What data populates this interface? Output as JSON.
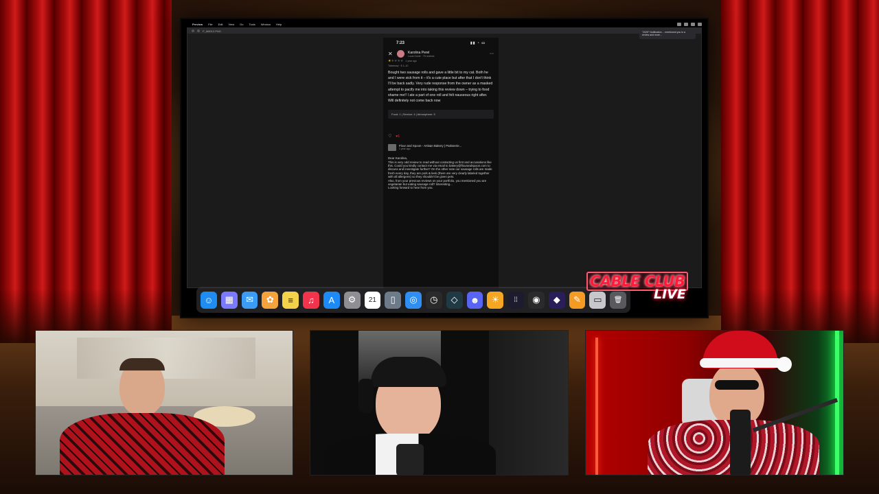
{
  "mac_menu": {
    "app": "Preview",
    "items": [
      "File",
      "Edit",
      "View",
      "Go",
      "Tools",
      "Window",
      "Help"
    ]
  },
  "browser": {
    "tab_title": "P_M8012.PNG",
    "notification": "\"2025\" Notification ... mentioned you in a review and more..."
  },
  "phone": {
    "time": "7:23",
    "review": {
      "reviewer": "Karolina Perel",
      "reviewer_meta": "Local Guide · 75 reviews",
      "stars_text": "★★★★★",
      "ago": "1 year ago",
      "meta": "Takeaway · $ 1–10",
      "text": "Bought two sausage rolls and gave a little bit to my cat. Both he and I were sick from it – it's a cute place but after that I don't think I'll be back sadly. Very rude response from the owner as a masked attempt to pacify me into taking this review down – trying to food shame me!! I ate a part of one roll and felt nauseous right after. Will definitely not come back now",
      "ratings": "Food: 1  |  Service: 4  |  Atmosphere: 5",
      "like_count": "1"
    },
    "owner": {
      "name": "Flour and Spoon - Artisan Bakery | Patisserie...",
      "time": "1 year ago",
      "reply": [
        "Dear Karolina,",
        "This is very odd review to read without contacting us first and accusations like this. Could you kindly contact me via email to bakery@flourandspoon.com to discuss and investigate further? On the other note our sausage rolls are made fresh every day, they are pork & leek (there are very clearly labeled together with all allergens) so they shouldn't be given pets.",
        "Also, from your previous reviews on your portfolio, you mentioned you are vegetarian but eating sausage roll? Interesting...",
        "Looking forward to hear from you."
      ]
    }
  },
  "dock": {
    "icons": [
      {
        "name": "finder-icon",
        "glyph": "☺",
        "color": "#1e8cf0"
      },
      {
        "name": "launchpad-icon",
        "glyph": "▦",
        "color": "#7a7aff"
      },
      {
        "name": "mail-icon",
        "glyph": "✉",
        "color": "#3a9cf5"
      },
      {
        "name": "photos-icon",
        "glyph": "✿",
        "color": "#f4a23c"
      },
      {
        "name": "notes-icon",
        "glyph": "≡",
        "color": "#f3d24a"
      },
      {
        "name": "music-icon",
        "glyph": "♫",
        "color": "#f2334c"
      },
      {
        "name": "app-store-icon",
        "glyph": "A",
        "color": "#1d8af5"
      },
      {
        "name": "settings-icon",
        "glyph": "⚙",
        "color": "#8e8e93"
      },
      {
        "name": "calendar-icon",
        "glyph": "21",
        "color": "#ffffff"
      },
      {
        "name": "iphone-mirroring-icon",
        "glyph": "▯",
        "color": "#6c7a8a"
      },
      {
        "name": "safari-icon",
        "glyph": "◎",
        "color": "#2f8ef2"
      },
      {
        "name": "clock-icon",
        "glyph": "◷",
        "color": "#2a2a2a"
      },
      {
        "name": "cursor-icon",
        "glyph": "◇",
        "color": "#1f3a44"
      },
      {
        "name": "discord-icon",
        "glyph": "☻",
        "color": "#5865f2"
      },
      {
        "name": "brightness-icon",
        "glyph": "☀",
        "color": "#f5a623"
      },
      {
        "name": "keypad-icon",
        "glyph": "⁞⁞",
        "color": "#1c1c2e"
      },
      {
        "name": "camera-icon",
        "glyph": "◉",
        "color": "#2a2a2a"
      },
      {
        "name": "proton-icon",
        "glyph": "◆",
        "color": "#2a1e5a"
      },
      {
        "name": "pages-icon",
        "glyph": "✎",
        "color": "#f59a23"
      },
      {
        "name": "finder-window-icon",
        "glyph": "▭",
        "color": "#c7c7cc"
      },
      {
        "name": "trash-icon",
        "glyph": "🗑",
        "color": "#5a5a5e"
      }
    ]
  },
  "logo": {
    "line1": "CABLE CLUB",
    "line2": "LIVE"
  },
  "colors": {
    "curtain": "#b00d0d",
    "brand_red": "#ff1b3a",
    "stars": "#f4b400"
  }
}
